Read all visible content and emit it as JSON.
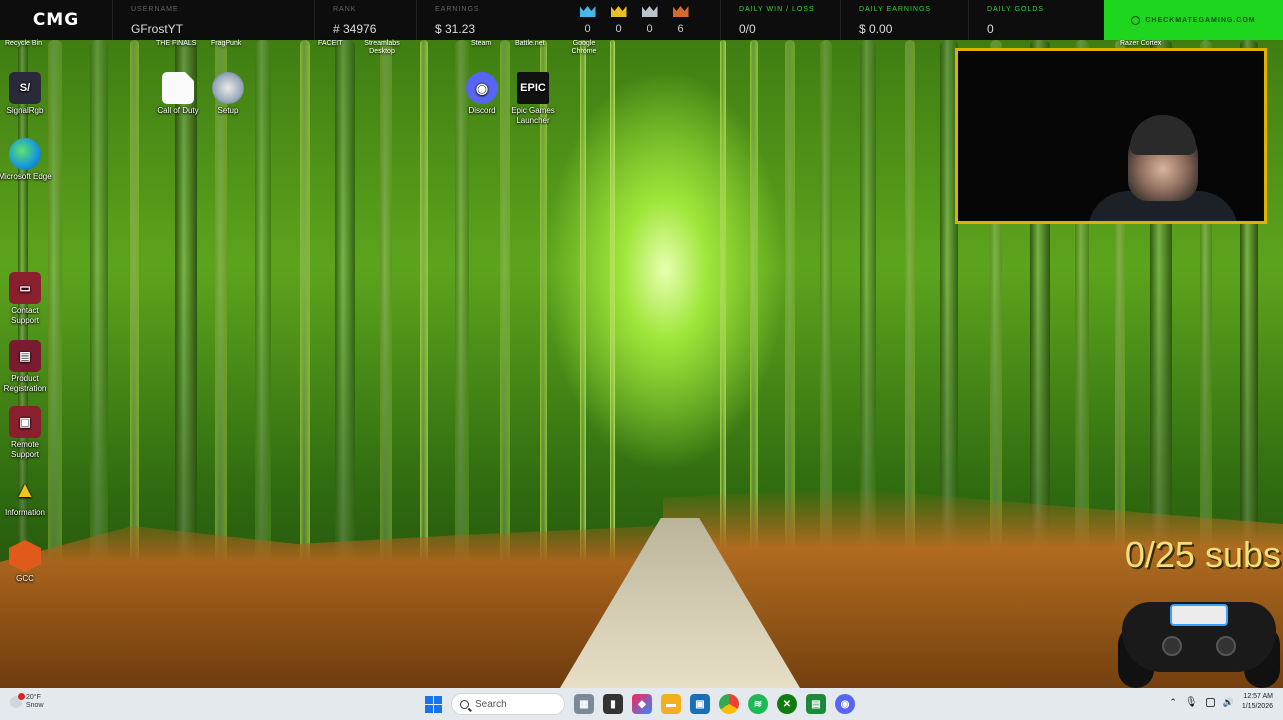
{
  "stats": {
    "logo": "CMG",
    "username_label": "USERNAME",
    "username": "GFrostYT",
    "rank_label": "RANK",
    "rank": "# 34976",
    "earnings_label": "EARNINGS",
    "earnings": "$ 31.23",
    "crowns": [
      {
        "color": "#46b7e8",
        "value": "0"
      },
      {
        "color": "#e8c026",
        "value": "0"
      },
      {
        "color": "#bcc3c8",
        "value": "0"
      },
      {
        "color": "#d46a2c",
        "value": "6"
      }
    ],
    "daily_wl_label": "DAILY WIN / LOSS",
    "daily_wl": "0/0",
    "daily_earnings_label": "DAILY EARNINGS",
    "daily_earnings": "$ 0.00",
    "daily_golds_label": "DAILY GOLDS",
    "daily_golds": "0",
    "brand": "CHECKMATEGAMING.COM"
  },
  "top_labels": {
    "recycle_bin": "Recycle Bin",
    "the_finals": "THE FINALS",
    "fragpunk": "FragPunk",
    "faceit": "FACEIT",
    "streamlabs": "Streamlabs Desktop",
    "steam": "Steam",
    "battlenet": "Battle.net",
    "google_chrome": "Google Chrome",
    "razer_cortex": "Razer Cortex"
  },
  "desktop_icons": {
    "signalrgb": "SignalRgb",
    "edge": "Microsoft Edge",
    "contact_support": "Contact Support",
    "product_registration": "Product Registration",
    "remote_support": "Remote Support",
    "information": "Information",
    "gcc": "GCC",
    "call_of_duty": "Call of Duty",
    "setup": "Setup",
    "discord": "Discord",
    "epic": "Epic Games Launcher",
    "epic_logo": "EPIC"
  },
  "overlay": {
    "subs": "0/25 subs"
  },
  "taskbar": {
    "temperature": "20°F",
    "condition": "Snow",
    "search_placeholder": "Search",
    "time": "12:57 AM",
    "date": "1/15/2026"
  },
  "colors": {
    "brand_green": "#1fd61f",
    "cam_border": "#e0b100",
    "subs_text": "#f2e07a"
  }
}
